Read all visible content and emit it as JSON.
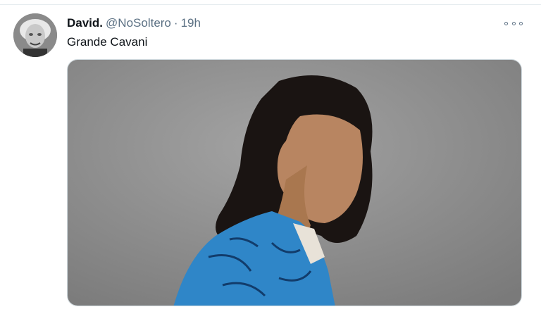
{
  "tweet": {
    "author_name": "David.",
    "author_handle": "@NoSoltero",
    "separator": "·",
    "timestamp": "19h",
    "text": "Grande Cavani",
    "more_icon": "more-horizontal-icon",
    "avatar": "avatar",
    "media": "tweet-photo"
  },
  "colors": {
    "primary_text": "#0f1419",
    "secondary_text": "#5b7083",
    "photo_background": "#8d8d8d",
    "shirt": "#2f86c8",
    "hair": "#1a1412"
  }
}
